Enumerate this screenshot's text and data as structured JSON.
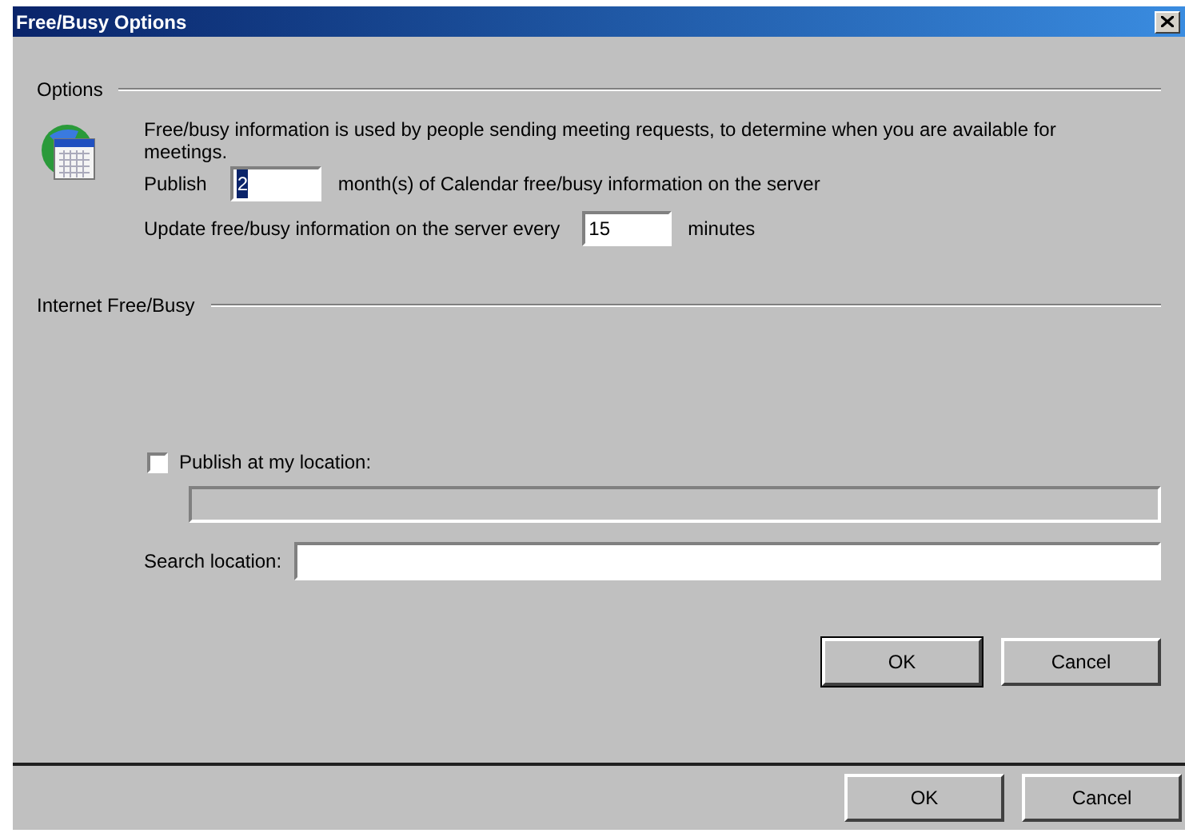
{
  "dialog": {
    "title": "Free/Busy Options",
    "options": {
      "heading": "Options",
      "description": "Free/busy information is used by people sending meeting requests, to determine when you are available for meetings.",
      "publish": {
        "label": "Publish",
        "value": "2",
        "value_selected": true,
        "suffix": "month(s) of Calendar free/busy information on the server"
      },
      "update": {
        "label": "Update free/busy information on the server every",
        "value": "15",
        "value_selected": false,
        "suffix": "minutes"
      }
    },
    "internet": {
      "heading": "Internet Free/Busy",
      "publish_checkbox": {
        "label": "Publish at my location:",
        "checked": false
      },
      "location_field": {
        "disabled": true
      },
      "search": {
        "label": "Search location:"
      }
    },
    "buttons": [
      "OK",
      "Cancel"
    ]
  },
  "parent_buttons": [
    "OK",
    "Cancel"
  ]
}
